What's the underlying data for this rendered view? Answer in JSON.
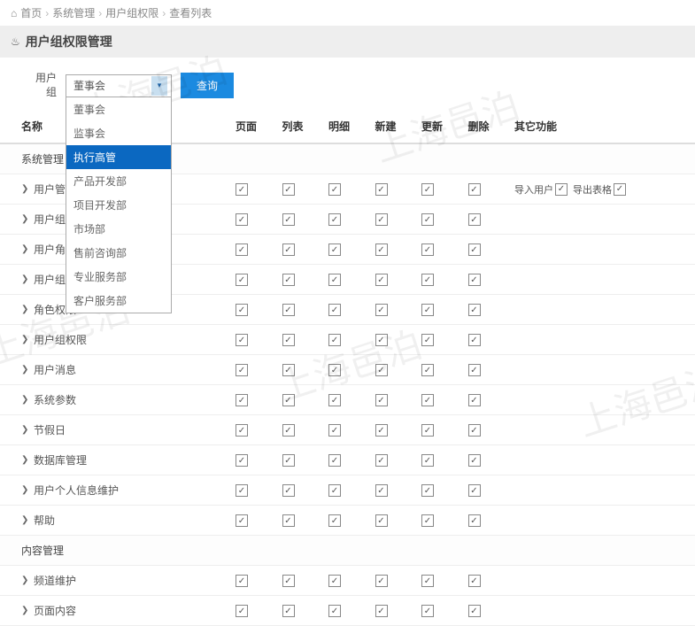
{
  "breadcrumb": {
    "home": "首页",
    "item1": "系统管理",
    "item2": "用户组权限",
    "item3": "查看列表"
  },
  "page_title": "用户组权限管理",
  "filter": {
    "label": "用户组",
    "selected": "董事会",
    "options": [
      {
        "label": "董事会",
        "active": false
      },
      {
        "label": "监事会",
        "active": false
      },
      {
        "label": "执行高管",
        "active": true
      },
      {
        "label": "产品开发部",
        "active": false
      },
      {
        "label": "项目开发部",
        "active": false
      },
      {
        "label": "市场部",
        "active": false
      },
      {
        "label": "售前咨询部",
        "active": false
      },
      {
        "label": "专业服务部",
        "active": false
      },
      {
        "label": "客户服务部",
        "active": false
      }
    ],
    "query_btn": "查询"
  },
  "columns": {
    "name": "名称",
    "page": "页面",
    "list": "列表",
    "detail": "明细",
    "create": "新建",
    "update": "更新",
    "delete": "删除",
    "other": "其它功能"
  },
  "rows": [
    {
      "type": "cat",
      "name": "系统管理"
    },
    {
      "type": "item",
      "name": "用户管理",
      "checks": [
        true,
        true,
        true,
        true,
        true,
        true
      ],
      "extra": [
        {
          "label": "导入用户",
          "checked": true
        },
        {
          "label": "导出表格",
          "checked": true
        }
      ]
    },
    {
      "type": "item",
      "name": "用户组维",
      "checks": [
        true,
        true,
        true,
        true,
        true,
        true
      ]
    },
    {
      "type": "item",
      "name": "用户角色",
      "checks": [
        true,
        true,
        true,
        true,
        true,
        true
      ]
    },
    {
      "type": "item",
      "name": "用户组用户分配",
      "checks": [
        true,
        true,
        true,
        true,
        true,
        true
      ]
    },
    {
      "type": "item",
      "name": "角色权限",
      "checks": [
        true,
        true,
        true,
        true,
        true,
        true
      ]
    },
    {
      "type": "item",
      "name": "用户组权限",
      "checks": [
        true,
        true,
        true,
        true,
        true,
        true
      ]
    },
    {
      "type": "item",
      "name": "用户消息",
      "checks": [
        true,
        true,
        true,
        true,
        true,
        true
      ]
    },
    {
      "type": "item",
      "name": "系统参数",
      "checks": [
        true,
        true,
        true,
        true,
        true,
        true
      ]
    },
    {
      "type": "item",
      "name": "节假日",
      "checks": [
        true,
        true,
        true,
        true,
        true,
        true
      ]
    },
    {
      "type": "item",
      "name": "数据库管理",
      "checks": [
        true,
        true,
        true,
        true,
        true,
        true
      ]
    },
    {
      "type": "item",
      "name": "用户个人信息维护",
      "checks": [
        true,
        true,
        true,
        true,
        true,
        true
      ]
    },
    {
      "type": "item",
      "name": "帮助",
      "checks": [
        true,
        true,
        true,
        true,
        true,
        true
      ]
    },
    {
      "type": "cat",
      "name": "内容管理"
    },
    {
      "type": "item",
      "name": "频道维护",
      "checks": [
        true,
        true,
        true,
        true,
        true,
        true
      ]
    },
    {
      "type": "item",
      "name": "页面内容",
      "checks": [
        true,
        true,
        true,
        true,
        true,
        true
      ]
    }
  ],
  "watermark": "上海邑泊"
}
